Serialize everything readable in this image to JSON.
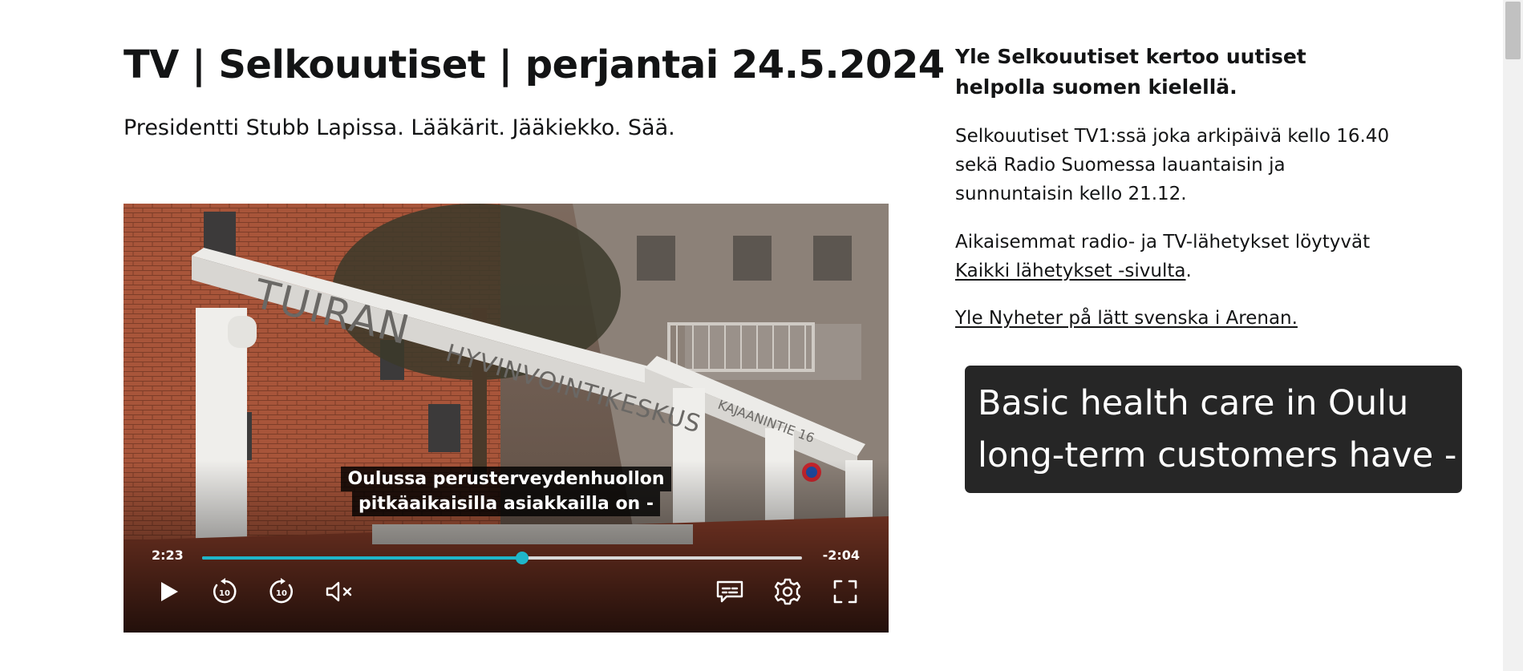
{
  "article": {
    "title": "TV | Selkouutiset | perjantai 24.5.2024",
    "subtitle": "Presidentti Stubb Lapissa. Lääkärit. Jääkiekko. Sää."
  },
  "player": {
    "subtitle_lines": [
      "Oulussa perusterveydenhuollon",
      "pitkäaikaisilla asiakkailla on -"
    ],
    "time_elapsed": "2:23",
    "time_remaining": "-2:04",
    "progress_fraction": 0.533,
    "accent_color": "#1fb6c9",
    "controls": {
      "play": "play-icon",
      "rewind": "rewind-10-icon",
      "forward": "forward-10-icon",
      "mute": "muted-speaker-icon",
      "subtitles": "subtitles-icon",
      "settings": "gear-icon",
      "fullscreen": "fullscreen-icon"
    }
  },
  "sidebar": {
    "heading": "Yle Selkouutiset kertoo uutiset helpolla suomen kielellä.",
    "paragraph1": "Selkouutiset TV1:ssä joka arkipäivä kello 16.40 sekä Radio Suomessa lauantaisin ja sunnuntaisin kello 21.12.",
    "paragraph2_text": "Aikaisemmat radio- ja TV-lähetykset löytyvät ",
    "paragraph2_link": "Kaikki lähetykset -sivulta",
    "paragraph2_end": ".",
    "link3": "Yle Nyheter på lätt svenska i Arenan."
  },
  "translation": {
    "lines": [
      "Basic health care in Oulu",
      "long-term customers have -"
    ]
  }
}
